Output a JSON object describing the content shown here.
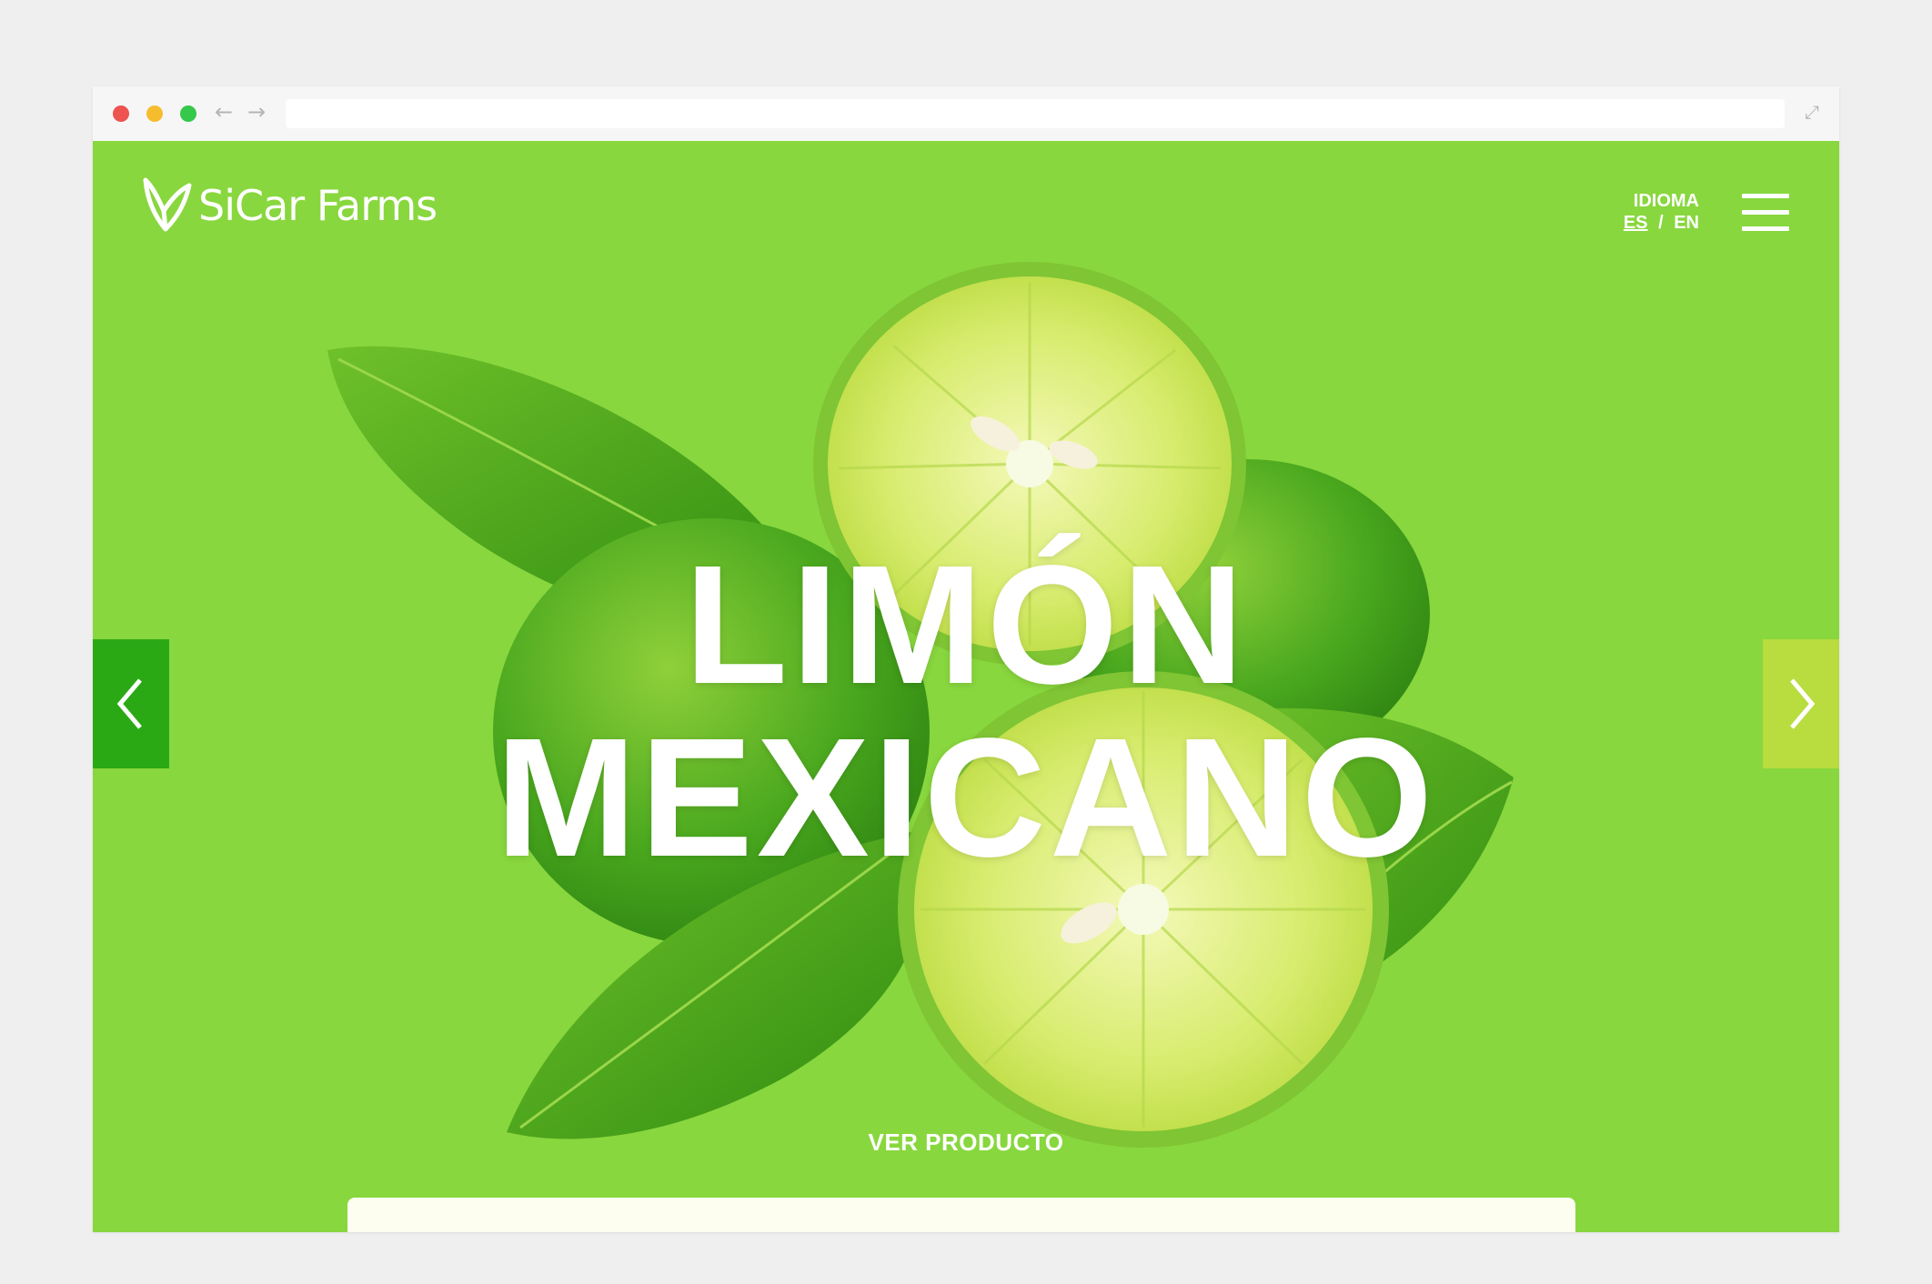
{
  "browser": {
    "back_icon": "arrow-left-icon",
    "forward_icon": "arrow-right-icon",
    "expand_icon": "expand-icon",
    "back_glyph": "←",
    "forward_glyph": "→",
    "expand_glyph": "⤢"
  },
  "header": {
    "brand": "SiCar Farms",
    "language_label": "IDIOMA",
    "languages": {
      "es": "ES",
      "separator": "/",
      "en": "EN",
      "active": "ES"
    },
    "menu_icon": "hamburger-icon"
  },
  "hero": {
    "title_line1": "LIMÓN",
    "title_line2": "MEXICANO",
    "cta": "VER PRODUCTO",
    "prev_icon": "chevron-left-icon",
    "next_icon": "chevron-right-icon"
  },
  "colors": {
    "background": "#88d73e",
    "prev_button": "#2aa915",
    "next_button": "#b9dc3f",
    "text": "#ffffff"
  }
}
